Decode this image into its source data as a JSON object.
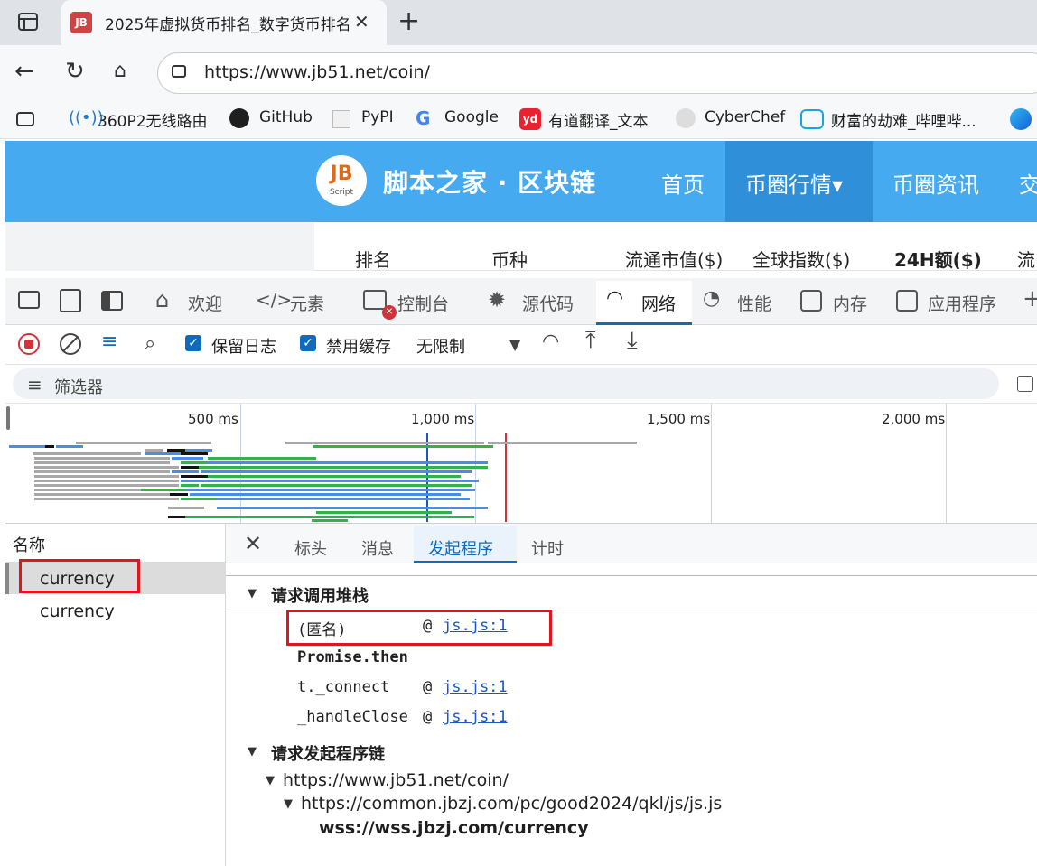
{
  "browser": {
    "tab_title": "2025年虚拟货币排名_数字货币排名",
    "url": "https://www.jb51.net/coin/",
    "bookmarks": [
      "360P2无线路由",
      "GitHub",
      "PyPI",
      "Google",
      "有道翻译_文本",
      "CyberChef",
      "财富的劫难_哔哩哔..."
    ]
  },
  "site": {
    "brand": "脚本之家 · 区块链",
    "logo_text": "JB",
    "logo_sub": "Script",
    "nav": [
      "首页",
      "币圈行情▾",
      "币圈资讯",
      "交"
    ],
    "columns": [
      "排名",
      "币种",
      "流通市值($)",
      "全球指数($)",
      "24H额($)",
      "流"
    ]
  },
  "devtools": {
    "tabs": [
      "欢迎",
      "元素",
      "控制台",
      "源代码",
      "网络",
      "性能",
      "内存",
      "应用程序"
    ],
    "active_tab": "网络",
    "controls": {
      "preserve_log": "保留日志",
      "disable_cache": "禁用缓存",
      "throttle": "无限制"
    },
    "filter_placeholder": "筛选器",
    "timeline_ticks": [
      "500 ms",
      "1,000 ms",
      "1,500 ms",
      "2,000 ms"
    ],
    "names_header": "名称",
    "requests": [
      "currency",
      "currency"
    ],
    "detail_tabs": [
      "标头",
      "消息",
      "发起程序",
      "计时"
    ],
    "active_detail_tab": "发起程序",
    "call_stack_title": "请求调用堆栈",
    "call_stack": [
      {
        "fn": "(匿名)",
        "at": "@",
        "link": "js.js:1"
      },
      {
        "fn": "Promise.then",
        "at": "",
        "link": ""
      },
      {
        "fn": "t._connect",
        "at": "@",
        "link": "js.js:1"
      },
      {
        "fn": "_handleClose",
        "at": "@",
        "link": "js.js:1"
      }
    ],
    "initiator_chain_title": "请求发起程序链",
    "initiator_chain": [
      "https://www.jb51.net/coin/",
      "https://common.jbzj.com/pc/good2024/qkl/js/js.js",
      "wss://wss.jbzj.com/currency"
    ]
  },
  "colors": {
    "site_blue": "#46aaf0",
    "accent": "#0f6cbd",
    "highlight_red": "#e0161c",
    "link": "#1a56c9"
  }
}
